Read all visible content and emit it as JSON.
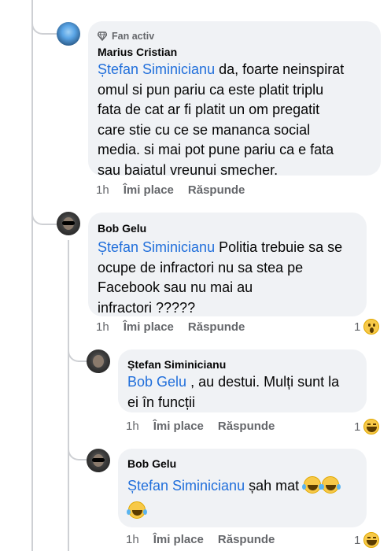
{
  "comments": [
    {
      "badge": "Fan activ",
      "author": "Marius Cristian",
      "mention": "Ștefan Siminicianu",
      "text_lines": [
        " da, foarte neinspirat",
        "omul si pun pariu ca este platit triplu",
        "fata de cat ar fi platit un om pregatit",
        "care stie cu ce se mananca social",
        "media. si mai pot pune pariu ca e fata",
        "sau baiatul vreunui smecher."
      ],
      "time": "1h",
      "like_label": "Îmi place",
      "reply_label": "Răspunde"
    },
    {
      "author": "Bob Gelu",
      "mention": "Ștefan Siminicianu",
      "text_lines": [
        "  Politia trebuie sa se",
        "ocupe de infractori nu sa stea pe",
        "Facebook  sau nu mai au",
        "infractori ?????"
      ],
      "time": "1h",
      "like_label": "Îmi place",
      "reply_label": "Răspunde",
      "reaction_count": "1",
      "reaction_icon": "wow-emoji-icon"
    },
    {
      "author": "Ștefan Siminicianu",
      "mention": "Bob Gelu",
      "text_lines": [
        " , au destui. Mulți sunt la",
        "ei în funcții"
      ],
      "time": "1h",
      "like_label": "Îmi place",
      "reply_label": "Răspunde",
      "reaction_count": "1",
      "reaction_icon": "haha-emoji-icon"
    },
    {
      "author": "Bob Gelu",
      "mention": "Ștefan Siminicianu",
      "text_after": "  șah mat ",
      "time": "1h",
      "like_label": "Îmi place",
      "reply_label": "Răspunde",
      "reaction_count": "1",
      "reaction_icon": "haha-emoji-icon"
    }
  ],
  "colors": {
    "mention": "#216fdb",
    "bubble": "#f0f2f5",
    "secondary_text": "#65676b",
    "thread_line": "#ced0d4"
  }
}
